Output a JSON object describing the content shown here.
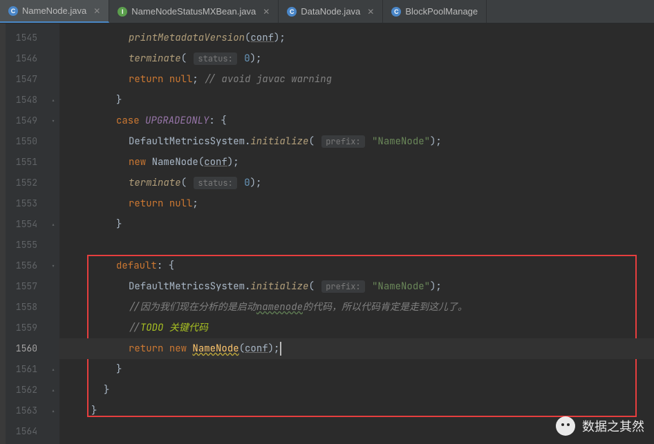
{
  "tabs": [
    {
      "label": "NameNode.java",
      "icon": "C",
      "iconClass": "ico-c",
      "active": true
    },
    {
      "label": "NameNodeStatusMXBean.java",
      "icon": "I",
      "iconClass": "ico-i",
      "active": false
    },
    {
      "label": "DataNode.java",
      "icon": "C",
      "iconClass": "ico-c",
      "active": false
    },
    {
      "label": "BlockPoolManage",
      "icon": "C",
      "iconClass": "ico-c",
      "active": false,
      "noclose": true
    }
  ],
  "gutter": {
    "start": 1545,
    "end": 1564,
    "highlight": 1560
  },
  "fold": {
    "1545": "",
    "1546": "",
    "1547": "",
    "1548": "▴",
    "1549": "▾",
    "1550": "",
    "1551": "",
    "1552": "",
    "1553": "",
    "1554": "▴",
    "1555": "",
    "1556": "▾",
    "1557": "",
    "1558": "",
    "1559": "",
    "1560": "",
    "1561": "▴",
    "1562": "▴",
    "1563": "▴",
    "1564": ""
  },
  "tokens": {
    "printMetadataVersion": "printMetadataVersion",
    "terminate": "terminate",
    "status_hint": "status:",
    "zero": "0",
    "return": "return",
    "null": "null",
    "avoid_comment": "// avoid javac warning",
    "case": "case",
    "UPGRADEONLY": "UPGRADEONLY",
    "DefaultMetricsSystem": "DefaultMetricsSystem",
    "initialize": "initialize",
    "prefix_hint": "prefix:",
    "NameNode_str": "\"NameNode\"",
    "new": "new",
    "NameNode": "NameNode",
    "conf": "conf",
    "default": "default",
    "cmt_cn_a": "//因为我们现在分析的是启动",
    "namenode_wavy": "namenode",
    "cmt_cn_b": "的代码，所以代码肯定是走到这儿了。",
    "todo_pre": "//",
    "todo_word": "TODO",
    "todo_rest": " 关键代码",
    "seg1": "( ",
    "seg2": ");",
    "seg_colon_brace": ": {",
    "seg_dot": ".",
    "seg_open": "(",
    "seg_close": ");",
    "seg_semi": ";",
    "brace_close": "}"
  },
  "watermark": "数据之其然"
}
